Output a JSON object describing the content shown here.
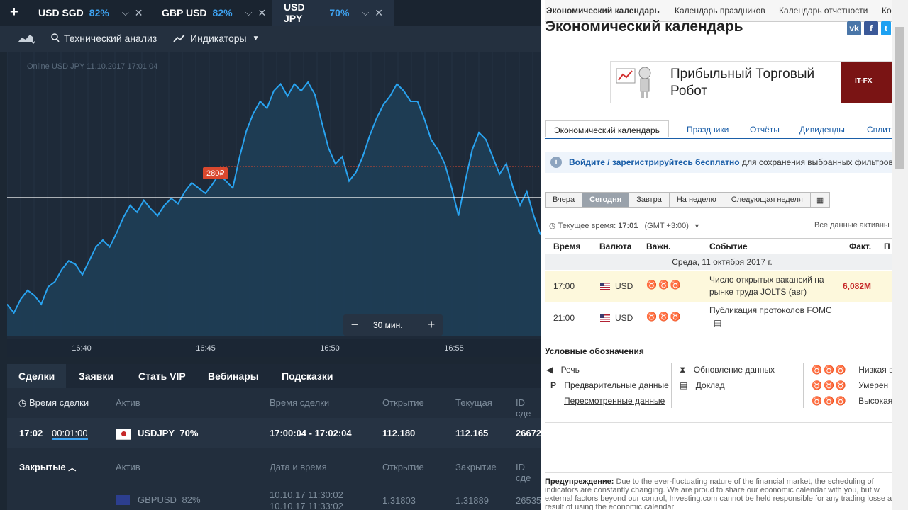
{
  "tabs": [
    {
      "label": "USD SGD",
      "pct": "82%"
    },
    {
      "label": "GBP USD",
      "pct": "82%"
    },
    {
      "label": "USD JPY",
      "pct": "70%"
    }
  ],
  "toolbar": {
    "tech_label": "Технический анализ",
    "ind_label": "Индикаторы"
  },
  "chart": {
    "caption": "Online USD JPY 11.10.2017 17:01:04",
    "price_tag": "280₽",
    "zoom_label": "30 мин.",
    "xticks": [
      "16:40",
      "16:45",
      "16:50",
      "16:55"
    ]
  },
  "chart_data": {
    "type": "line",
    "series": [
      {
        "values": [
          112.155,
          112.15,
          112.158,
          112.163,
          112.16,
          112.155,
          112.165,
          112.168,
          112.175,
          112.18,
          112.178,
          112.172,
          112.18,
          112.188,
          112.192,
          112.188,
          112.196,
          112.205,
          112.212,
          112.208,
          112.215,
          112.21,
          112.206,
          112.212,
          112.216,
          112.213,
          112.22,
          112.225,
          112.222,
          112.219,
          112.224,
          112.23,
          112.226,
          112.222,
          112.24,
          112.255,
          112.265,
          112.272,
          112.268,
          112.278,
          112.282,
          112.275,
          112.282,
          112.278,
          112.283,
          112.276,
          112.26,
          112.245,
          112.236,
          112.24,
          112.226,
          112.231,
          112.24,
          112.252,
          112.262,
          112.27,
          112.275,
          112.282,
          112.278,
          112.272,
          112.272,
          112.262,
          112.25,
          112.244,
          112.236,
          112.222,
          112.206,
          112.226,
          112.244,
          112.254,
          112.25,
          112.24,
          112.23,
          112.236,
          112.222,
          112.212,
          112.22,
          112.206,
          112.195
        ]
      }
    ],
    "current_price": 112.18
  },
  "bottom": {
    "tabs": [
      "Сделки",
      "Заявки",
      "Стать VIP",
      "Вебинары",
      "Подсказки"
    ],
    "headers": {
      "time": "Время сделки",
      "asset": "Актив",
      "deal_time": "Время сделки",
      "open": "Открытие",
      "current": "Текущая",
      "id": "ID сде"
    },
    "active_row": {
      "time": "17:02",
      "timer": "00:01:00",
      "asset": "USDJPY",
      "pct": "70%",
      "range": "17:00:04 - 17:02:04",
      "open": "112.180",
      "current": "112.165",
      "id": "26672"
    },
    "closed_headers": {
      "label": "Закрытые",
      "asset": "Актив",
      "date": "Дата и время",
      "open": "Открытие",
      "close": "Закрытие",
      "id": "ID сде"
    },
    "closed_row": {
      "asset": "GBPUSD",
      "pct": "82%",
      "date1": "10.10.17 11:30:02",
      "date2": "10.10.17 11:33:02",
      "open": "1.31803",
      "close": "1.31889",
      "id": "26535"
    }
  },
  "investing": {
    "topnav": [
      "Экономический календарь",
      "Календарь праздников",
      "Календарь отчетности",
      "Ко"
    ],
    "title": "Экономический календарь",
    "ad_text": "Прибыльный Торговый Робот",
    "ad_brand": "IT-FX",
    "subtabs": [
      "Экономический календарь",
      "Праздники",
      "Отчёты",
      "Дивиденды",
      "Сплит"
    ],
    "info_link": "Войдите / зарегистрируйтесь бесплатно",
    "info_rest": "для сохранения выбранных фильтров",
    "day_buttons": [
      "Вчера",
      "Сегодня",
      "Завтра",
      "На неделю",
      "Следующая неделя"
    ],
    "time_label": "Текущее время:",
    "time_value": "17:01",
    "tz": "(GMT +3:00)",
    "all_active": "Все данные активны",
    "headers": [
      "Время",
      "Валюта",
      "Важн.",
      "Событие",
      "Факт.",
      "П"
    ],
    "date_row": "Среда, 11 октября 2017 г.",
    "events": [
      {
        "time": "17:00",
        "currency": "USD",
        "event": "Число открытых вакансий на рынке труда JOLTS (авг)",
        "fact": "6,082M"
      },
      {
        "time": "21:00",
        "currency": "USD",
        "event": "Публикация протоколов FOMC",
        "fact": ""
      }
    ],
    "legend_title": "Условные обозначения",
    "legend": [
      "Речь",
      "Предварительные данные",
      "Пересмотренные данные",
      "Обновление данных",
      "Доклад",
      "Низкая в",
      "Умерен",
      "Высокая"
    ],
    "warning_label": "Предупреждение:",
    "warning_text": "Due to the ever-fluctuating nature of the financial market, the scheduling of indicators are constantly changing. We are proud to share our economic calendar with you, but w external factors beyond our control, Investing.com cannot be held responsible for any trading losse a result of using the economic calendar"
  }
}
